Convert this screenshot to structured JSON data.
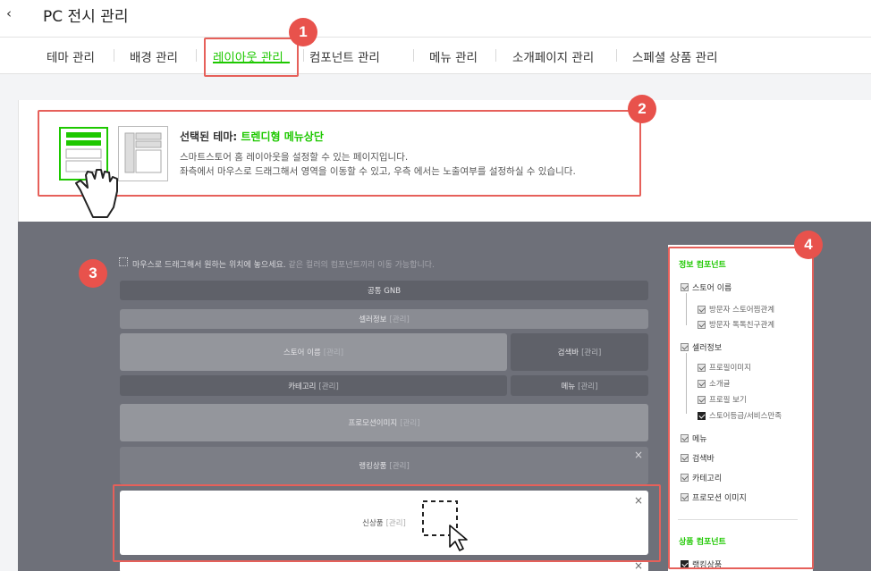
{
  "header": {
    "back_icon": "chevron-left-icon",
    "title": "PC 전시 관리"
  },
  "tabs": [
    {
      "label": "테마 관리"
    },
    {
      "label": "배경 관리"
    },
    {
      "label": "레이아웃 관리",
      "active": true
    },
    {
      "label": "컴포넌트 관리"
    },
    {
      "label": "메뉴 관리"
    },
    {
      "label": "소개페이지 관리"
    },
    {
      "label": "스페셜 상품 관리"
    }
  ],
  "badges": [
    "1",
    "2",
    "3",
    "4"
  ],
  "info": {
    "title_prefix": "선택된 테마:",
    "title_theme": "트렌디형 메뉴상단",
    "line1": "스마트스토어 홈 레이아웃을 설정할 수 있는 페이지입니다.",
    "line2": "좌측에서 마우스로 드래그해서 영역을 이동할 수 있고, 우측 에서는 노출여부를 설정하실 수 있습니다."
  },
  "layout": {
    "hint": "마우스로 드래그해서 원하는 위치에 놓으세요.",
    "hint_sub": "같은 컬러의 컴포넌트끼리 이동 가능합니다.",
    "blocks": {
      "gnb": "공통 GNB",
      "seller": "셀러정보",
      "store_name": "스토어 이름",
      "search": "검색바",
      "category": "카테고리",
      "menu": "메뉴",
      "promo": "프로모션이미지",
      "ranking": "랭킹상품",
      "new": "신상품"
    },
    "tag": "[관리]",
    "close": "×"
  },
  "right_panel": {
    "info_head": "정보 컴포넌트",
    "product_head": "상품 컴포넌트",
    "items": {
      "store_name": "스토어 이름",
      "visitor_store": "방문자 스토어찜관계",
      "visitor_talk": "방문자 톡톡친구관계",
      "seller": "셀러정보",
      "profile_img": "프로필이미지",
      "intro": "소개글",
      "profile_view": "프로필 보기",
      "store_grade": "스토어등급/서비스만족",
      "menu": "메뉴",
      "search": "검색바",
      "category": "카테고리",
      "promo": "프로모션 이미지",
      "ranking": "랭킹상품"
    }
  },
  "colors": {
    "accent": "#1ec800",
    "highlight": "#e6605a",
    "badge": "#e8524c",
    "layout_bg": "#6e7079"
  }
}
